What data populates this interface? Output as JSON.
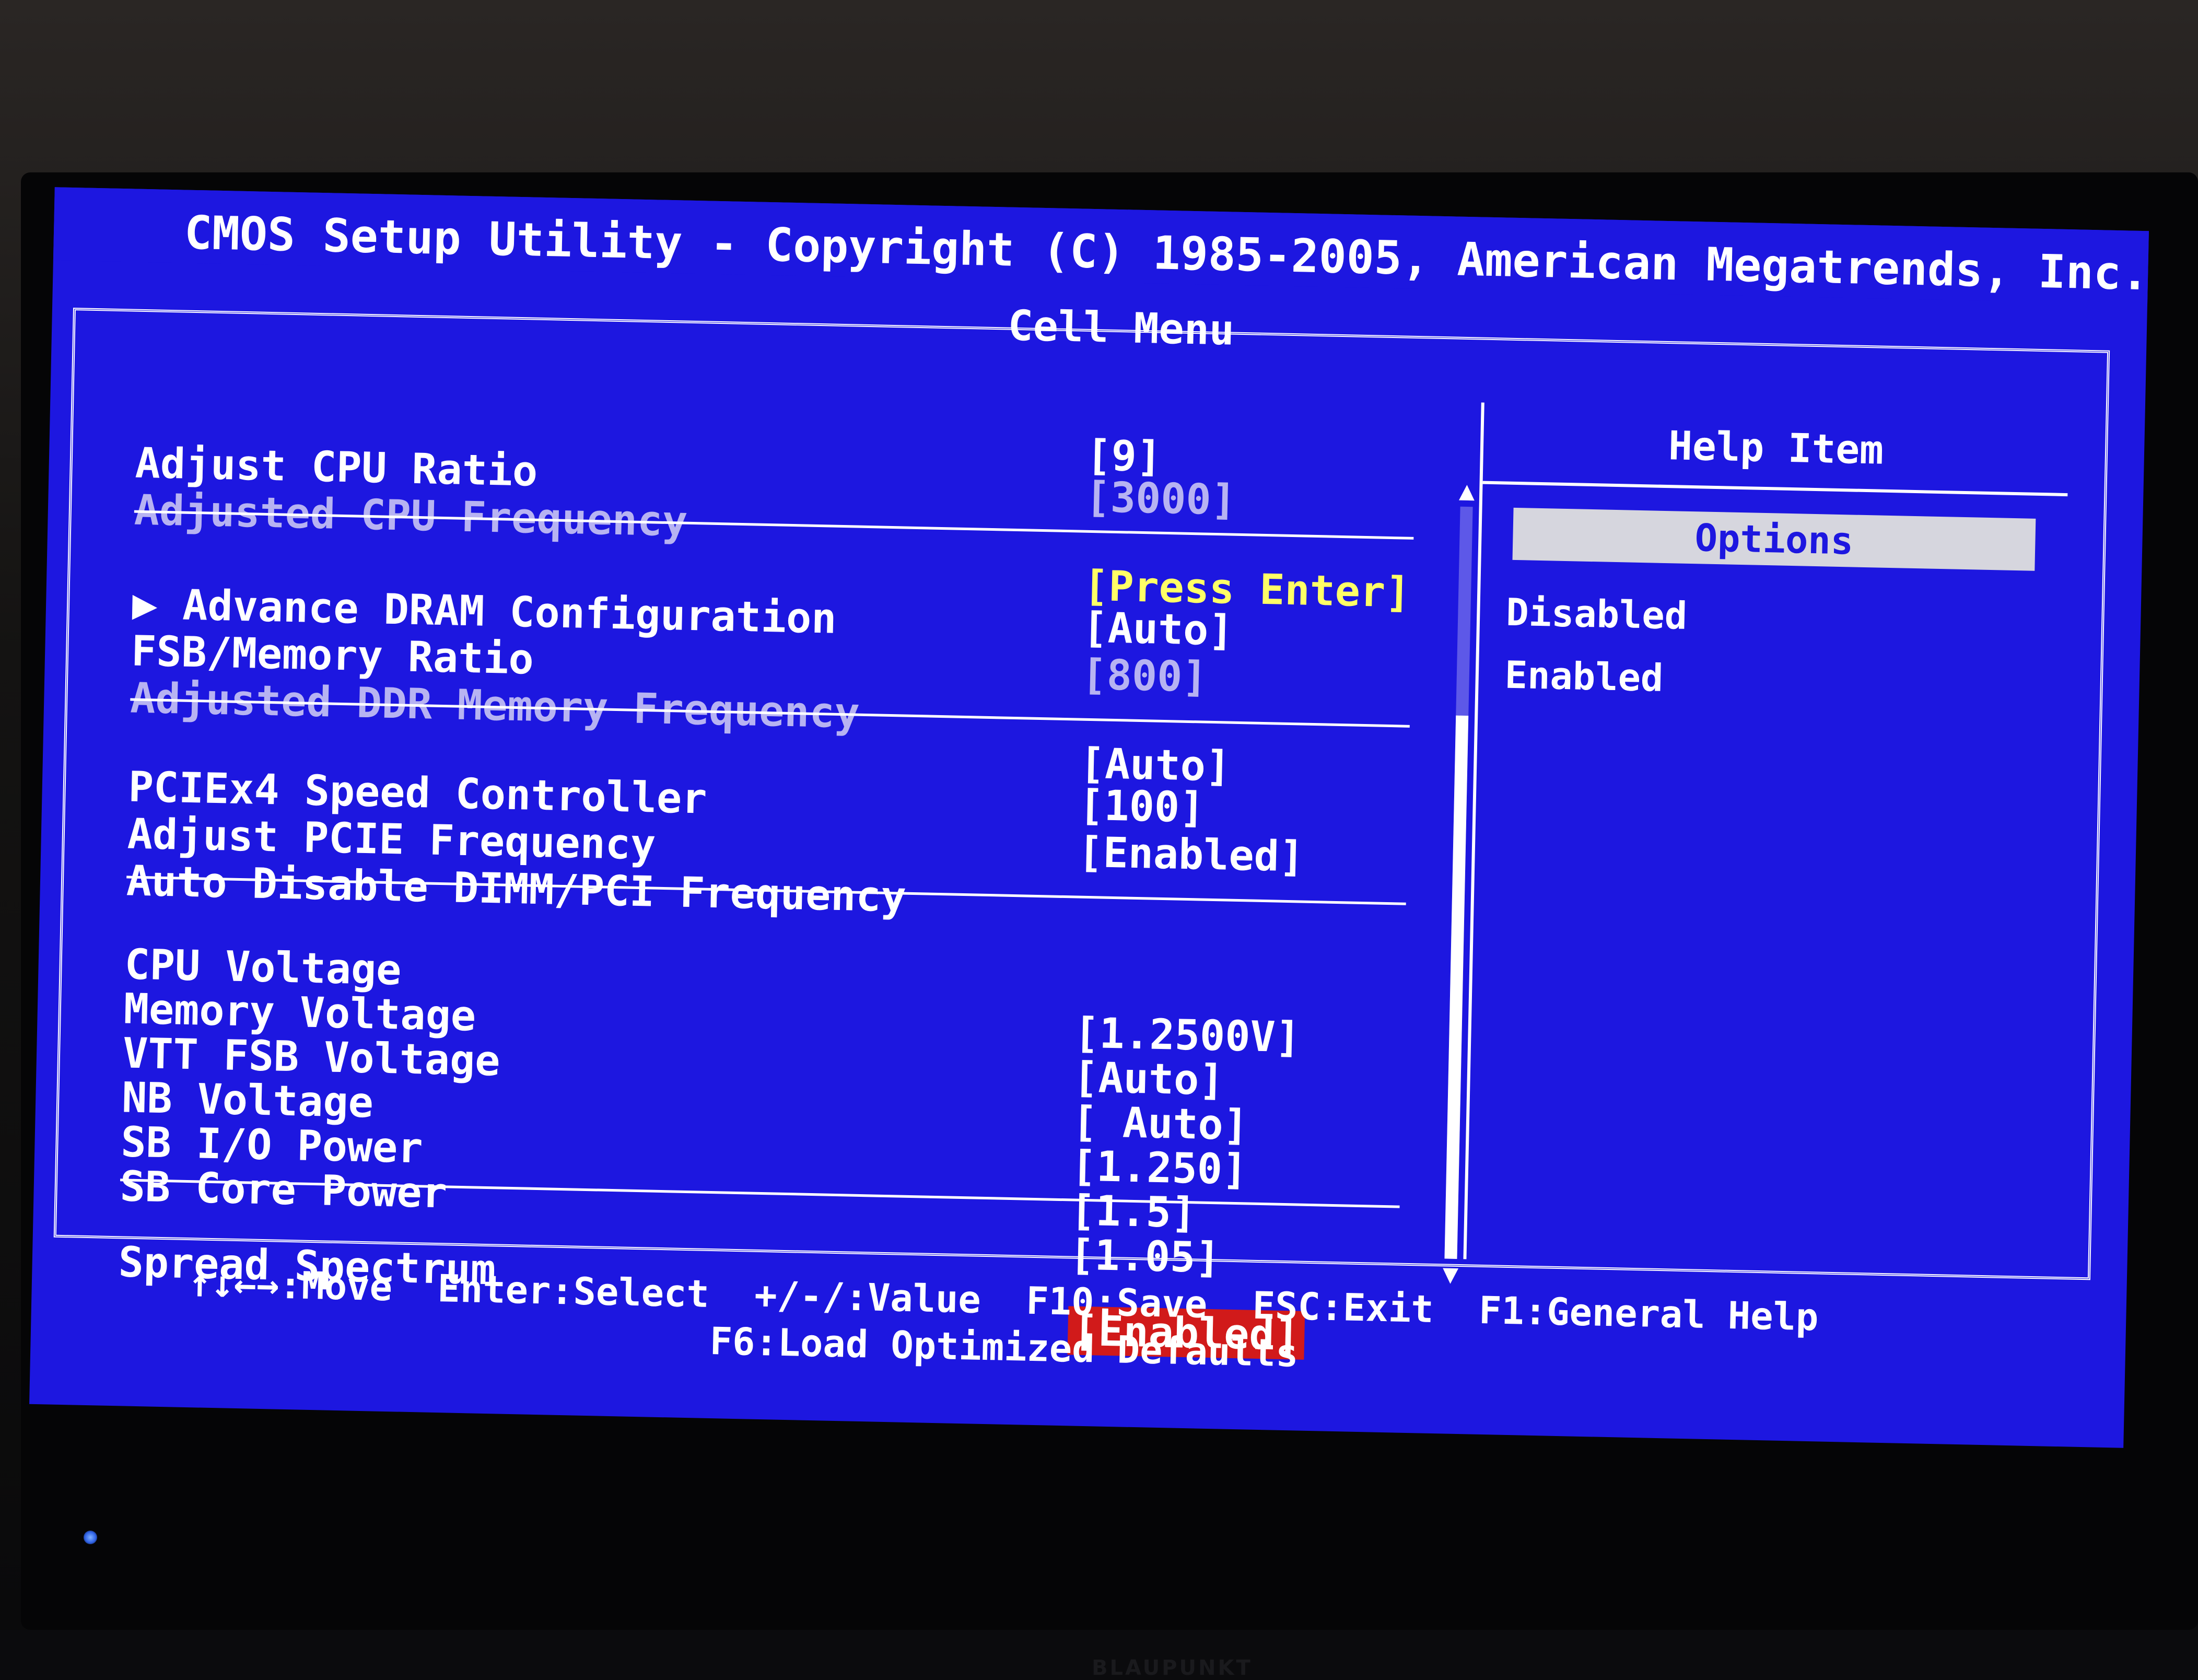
{
  "header": {
    "title": "CMOS Setup Utility - Copyright (C) 1985-2005, American Megatrends, Inc.",
    "menu_name": "Cell Menu"
  },
  "main": {
    "items": [
      {
        "label": "Adjust CPU Ratio",
        "value": "[9]",
        "style": "normal"
      },
      {
        "label": "Adjusted CPU Frequency",
        "value": "[3000]",
        "style": "dim"
      },
      {
        "label": "▶ Advance DRAM Configuration",
        "value": "[Press Enter]",
        "style": "submenu"
      },
      {
        "label": "FSB/Memory Ratio",
        "value": "[Auto]",
        "style": "normal"
      },
      {
        "label": "Adjusted DDR Memory Frequency",
        "value": "[800]",
        "style": "dim"
      },
      {
        "label": "PCIEx4 Speed Controller",
        "value": "[Auto]",
        "style": "normal"
      },
      {
        "label": "Adjust PCIE Frequency",
        "value": "[100]",
        "style": "normal"
      },
      {
        "label": "Auto Disable DIMM/PCI Frequency",
        "value": "[Enabled]",
        "style": "normal"
      },
      {
        "label": "CPU Voltage",
        "value": "[1.2500V]",
        "style": "normal"
      },
      {
        "label": "Memory Voltage",
        "value": "[Auto]",
        "style": "normal"
      },
      {
        "label": "VTT FSB Voltage",
        "value": "[ Auto]",
        "style": "normal"
      },
      {
        "label": "NB Voltage",
        "value": "[1.250]",
        "style": "normal"
      },
      {
        "label": "SB I/O Power",
        "value": "[1.5]",
        "style": "normal"
      },
      {
        "label": "SB Core Power",
        "value": "[1.05]",
        "style": "normal"
      },
      {
        "label": "Spread Spectrum",
        "value": "[Enabled]",
        "style": "selected"
      }
    ],
    "scroll_position_fraction": 0.3
  },
  "help": {
    "title": "Help Item",
    "options_label": "Options",
    "options": [
      "Disabled",
      "Enabled"
    ]
  },
  "footer": {
    "line1": "↑↓←→:Move  Enter:Select  +/-/:Value  F10:Save  ESC:Exit  F1:General Help",
    "line2": "F6:Load Optimized Defaults"
  },
  "monitor": {
    "brand": "BLAUPUNKT"
  },
  "colors": {
    "screen_bg": "#1d17e0",
    "selected_bg": "#d11a1a",
    "submenu_value": "#ffff66",
    "dim_text": "#b7b3f2"
  }
}
